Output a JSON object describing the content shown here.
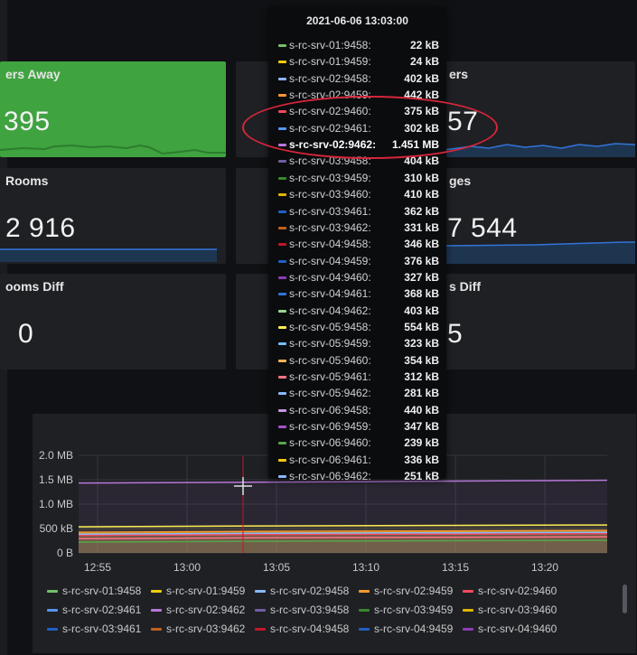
{
  "stats": {
    "users_away": {
      "title": "ers Away",
      "value": "395"
    },
    "users": {
      "title": "ers",
      "value": "57"
    },
    "rooms": {
      "title": "Rooms",
      "value": "2 916"
    },
    "messages": {
      "title": "ges",
      "value": "7 544"
    },
    "rooms_diff": {
      "title": "ooms Diff",
      "value": "0"
    },
    "messages_diff": {
      "title": "s Diff",
      "value": "5"
    }
  },
  "tooltip": {
    "time": "2021-06-06 13:03:00",
    "rows": [
      {
        "name": "s-rc-srv-01:9458:",
        "value": "22 kB",
        "color": "#73bf69"
      },
      {
        "name": "s-rc-srv-01:9459:",
        "value": "24 kB",
        "color": "#f2cc0c"
      },
      {
        "name": "s-rc-srv-02:9458:",
        "value": "402 kB",
        "color": "#8ab8ff"
      },
      {
        "name": "s-rc-srv-02:9459:",
        "value": "442 kB",
        "color": "#ff9830"
      },
      {
        "name": "s-rc-srv-02:9460:",
        "value": "375 kB",
        "color": "#f2495c"
      },
      {
        "name": "s-rc-srv-02:9461:",
        "value": "302 kB",
        "color": "#5794f2"
      },
      {
        "name": "s-rc-srv-02:9462:",
        "value": "1.451 MB",
        "color": "#b877d9",
        "highlight": true
      },
      {
        "name": "s-rc-srv-03:9458:",
        "value": "404 kB",
        "color": "#705da0"
      },
      {
        "name": "s-rc-srv-03:9459:",
        "value": "310 kB",
        "color": "#37872d"
      },
      {
        "name": "s-rc-srv-03:9460:",
        "value": "410 kB",
        "color": "#e0b400"
      },
      {
        "name": "s-rc-srv-03:9461:",
        "value": "362 kB",
        "color": "#1f60c4"
      },
      {
        "name": "s-rc-srv-03:9462:",
        "value": "331 kB",
        "color": "#c4601b"
      },
      {
        "name": "s-rc-srv-04:9458:",
        "value": "346 kB",
        "color": "#c4162a"
      },
      {
        "name": "s-rc-srv-04:9459:",
        "value": "376 kB",
        "color": "#1f60c4"
      },
      {
        "name": "s-rc-srv-04:9460:",
        "value": "327 kB",
        "color": "#8f3bb8"
      },
      {
        "name": "s-rc-srv-04:9461:",
        "value": "368 kB",
        "color": "#3274d9"
      },
      {
        "name": "s-rc-srv-04:9462:",
        "value": "403 kB",
        "color": "#96d98d"
      },
      {
        "name": "s-rc-srv-05:9458:",
        "value": "554 kB",
        "color": "#ffee52"
      },
      {
        "name": "s-rc-srv-05:9459:",
        "value": "323 kB",
        "color": "#73bfff"
      },
      {
        "name": "s-rc-srv-05:9460:",
        "value": "354 kB",
        "color": "#ffb357"
      },
      {
        "name": "s-rc-srv-05:9461:",
        "value": "312 kB",
        "color": "#ff7383"
      },
      {
        "name": "s-rc-srv-05:9462:",
        "value": "281 kB",
        "color": "#8ab8ff"
      },
      {
        "name": "s-rc-srv-06:9458:",
        "value": "440 kB",
        "color": "#ca95e5"
      },
      {
        "name": "s-rc-srv-06:9459:",
        "value": "347 kB",
        "color": "#a352cc"
      },
      {
        "name": "s-rc-srv-06:9460:",
        "value": "239 kB",
        "color": "#56a64b"
      },
      {
        "name": "s-rc-srv-06:9461:",
        "value": "336 kB",
        "color": "#f2cc0c"
      },
      {
        "name": "s-rc-srv-06:9462:",
        "value": "251 kB",
        "color": "#8ab8ff"
      }
    ]
  },
  "chart_data": {
    "type": "line",
    "ylim": [
      0,
      2000000
    ],
    "yticks": [
      "0 B",
      "500 kB",
      "1.0 MB",
      "1.5 MB",
      "2.0 MB"
    ],
    "xticks": [
      "12:55",
      "13:00",
      "13:05",
      "13:10",
      "13:15",
      "13:20"
    ],
    "cursor_time": "13:03",
    "series": [
      {
        "name": "s-rc-srv-02:9462",
        "color": "#b877d9",
        "value": 1451000
      },
      {
        "name": "s-rc-srv-05:9458",
        "color": "#ffee52",
        "value": 554000
      },
      {
        "name": "s-rc-srv-02:9459",
        "color": "#ff9830",
        "value": 442000
      },
      {
        "name": "s-rc-srv-03:9460",
        "color": "#e0b400",
        "value": 410000
      },
      {
        "name": "s-rc-srv-02:9458",
        "color": "#8ab8ff",
        "value": 402000
      },
      {
        "name": "s-rc-srv-02:9460",
        "color": "#f2495c",
        "value": 375000
      },
      {
        "name": "s-rc-srv-04:9462",
        "color": "#96d98d",
        "value": 403000
      },
      {
        "name": "s-rc-srv-05:9461",
        "color": "#ff7383",
        "value": 312000
      },
      {
        "name": "s-rc-srv-06:9460",
        "color": "#56a64b",
        "value": 239000
      }
    ]
  },
  "legend": [
    {
      "name": "s-rc-srv-01:9458",
      "color": "#73bf69"
    },
    {
      "name": "s-rc-srv-01:9459",
      "color": "#f2cc0c"
    },
    {
      "name": "s-rc-srv-02:9458",
      "color": "#8ab8ff"
    },
    {
      "name": "s-rc-srv-02:9459",
      "color": "#ff9830"
    },
    {
      "name": "s-rc-srv-02:9460",
      "color": "#f2495c"
    },
    {
      "name": "s-rc-srv-02:9461",
      "color": "#5794f2"
    },
    {
      "name": "s-rc-srv-02:9462",
      "color": "#b877d9"
    },
    {
      "name": "s-rc-srv-03:9458",
      "color": "#705da0"
    },
    {
      "name": "s-rc-srv-03:9459",
      "color": "#37872d"
    },
    {
      "name": "s-rc-srv-03:9460",
      "color": "#e0b400"
    },
    {
      "name": "s-rc-srv-03:9461",
      "color": "#1f60c4"
    },
    {
      "name": "s-rc-srv-03:9462",
      "color": "#c4601b"
    },
    {
      "name": "s-rc-srv-04:9458",
      "color": "#c4162a"
    },
    {
      "name": "s-rc-srv-04:9459",
      "color": "#1f60c4"
    },
    {
      "name": "s-rc-srv-04:9460",
      "color": "#8f3bb8"
    }
  ]
}
